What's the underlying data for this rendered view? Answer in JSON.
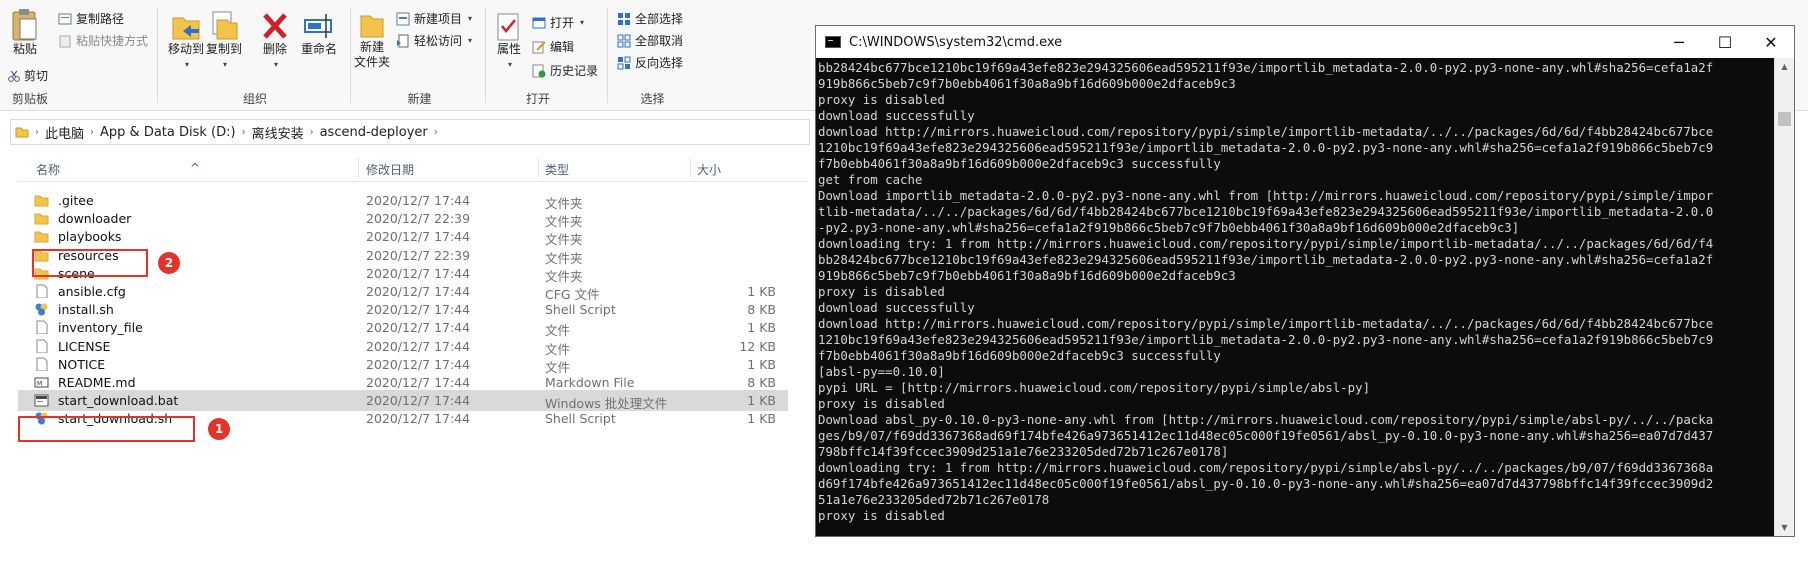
{
  "ribbon": {
    "clipboard": {
      "label": "剪贴板",
      "paste": "粘贴",
      "copy_path": "复制路径",
      "paste_shortcut": "粘贴快捷方式",
      "cut": "剪切"
    },
    "organize": {
      "label": "组织",
      "move_to": "移动到",
      "copy_to": "复制到",
      "delete": "删除",
      "rename": "重命名"
    },
    "new": {
      "label": "新建",
      "new_folder": "新建\n文件夹",
      "new_item": "新建项目",
      "easy_access": "轻松访问"
    },
    "open": {
      "label": "打开",
      "properties": "属性",
      "open": "打开",
      "edit": "编辑",
      "history": "历史记录"
    },
    "select": {
      "label": "选择",
      "select_all": "全部选择",
      "select_none": "全部取消",
      "invert": "反向选择"
    }
  },
  "address": {
    "crumbs": [
      "此电脑",
      "App & Data Disk (D:)",
      "离线安装",
      "ascend-deployer"
    ]
  },
  "columns": {
    "name": "名称",
    "date": "修改日期",
    "type": "类型",
    "size": "大小"
  },
  "files": [
    {
      "name": ".gitee",
      "date": "2020/12/7 17:44",
      "type": "文件夹",
      "size": "",
      "icon": "folder-icon"
    },
    {
      "name": "downloader",
      "date": "2020/12/7 22:39",
      "type": "文件夹",
      "size": "",
      "icon": "folder-icon"
    },
    {
      "name": "playbooks",
      "date": "2020/12/7 17:44",
      "type": "文件夹",
      "size": "",
      "icon": "folder-icon"
    },
    {
      "name": "resources",
      "date": "2020/12/7 22:39",
      "type": "文件夹",
      "size": "",
      "icon": "folder-icon"
    },
    {
      "name": "scene",
      "date": "2020/12/7 17:44",
      "type": "文件夹",
      "size": "",
      "icon": "folder-icon"
    },
    {
      "name": "ansible.cfg",
      "date": "2020/12/7 17:44",
      "type": "CFG 文件",
      "size": "1 KB",
      "icon": "file-icon"
    },
    {
      "name": "install.sh",
      "date": "2020/12/7 17:44",
      "type": "Shell Script",
      "size": "8 KB",
      "icon": "shell-script-icon"
    },
    {
      "name": "inventory_file",
      "date": "2020/12/7 17:44",
      "type": "文件",
      "size": "1 KB",
      "icon": "file-icon"
    },
    {
      "name": "LICENSE",
      "date": "2020/12/7 17:44",
      "type": "文件",
      "size": "12 KB",
      "icon": "file-icon"
    },
    {
      "name": "NOTICE",
      "date": "2020/12/7 17:44",
      "type": "文件",
      "size": "1 KB",
      "icon": "file-icon"
    },
    {
      "name": "README.md",
      "date": "2020/12/7 17:44",
      "type": "Markdown File",
      "size": "8 KB",
      "icon": "markdown-file-icon"
    },
    {
      "name": "start_download.bat",
      "date": "2020/12/7 17:44",
      "type": "Windows 批处理文件",
      "size": "1 KB",
      "icon": "batch-file-icon",
      "selected": true
    },
    {
      "name": "start_download.sh",
      "date": "2020/12/7 17:44",
      "type": "Shell Script",
      "size": "1 KB",
      "icon": "shell-script-icon"
    }
  ],
  "annotations": {
    "badge_1": "1",
    "badge_2": "2"
  },
  "cmd": {
    "title": "C:\\WINDOWS\\system32\\cmd.exe",
    "lines": [
      "bb28424bc677bce1210bc19f69a43efe823e294325606ead595211f93e/importlib_metadata-2.0.0-py2.py3-none-any.whl#sha256=cefa1a2f",
      "919b866c5beb7c9f7b0ebb4061f30a8a9bf16d609b000e2dfaceb9c3",
      "proxy is disabled",
      "download successfully",
      "download http://mirrors.huaweicloud.com/repository/pypi/simple/importlib-metadata/../../packages/6d/6d/f4bb28424bc677bce",
      "1210bc19f69a43efe823e294325606ead595211f93e/importlib_metadata-2.0.0-py2.py3-none-any.whl#sha256=cefa1a2f919b866c5beb7c9",
      "f7b0ebb4061f30a8a9bf16d609b000e2dfaceb9c3 successfully",
      "get from cache",
      "Download importlib_metadata-2.0.0-py2.py3-none-any.whl from [http://mirrors.huaweicloud.com/repository/pypi/simple/impor",
      "tlib-metadata/../../packages/6d/6d/f4bb28424bc677bce1210bc19f69a43efe823e294325606ead595211f93e/importlib_metadata-2.0.0",
      "-py2.py3-none-any.whl#sha256=cefa1a2f919b866c5beb7c9f7b0ebb4061f30a8a9bf16d609b000e2dfaceb9c3]",
      "downloading try: 1 from http://mirrors.huaweicloud.com/repository/pypi/simple/importlib-metadata/../../packages/6d/6d/f4",
      "bb28424bc677bce1210bc19f69a43efe823e294325606ead595211f93e/importlib_metadata-2.0.0-py2.py3-none-any.whl#sha256=cefa1a2f",
      "919b866c5beb7c9f7b0ebb4061f30a8a9bf16d609b000e2dfaceb9c3",
      "proxy is disabled",
      "download successfully",
      "download http://mirrors.huaweicloud.com/repository/pypi/simple/importlib-metadata/../../packages/6d/6d/f4bb28424bc677bce",
      "1210bc19f69a43efe823e294325606ead595211f93e/importlib_metadata-2.0.0-py2.py3-none-any.whl#sha256=cefa1a2f919b866c5beb7c9",
      "f7b0ebb4061f30a8a9bf16d609b000e2dfaceb9c3 successfully",
      "[absl-py==0.10.0]",
      "pypi URL = [http://mirrors.huaweicloud.com/repository/pypi/simple/absl-py]",
      "proxy is disabled",
      "Download absl_py-0.10.0-py3-none-any.whl from [http://mirrors.huaweicloud.com/repository/pypi/simple/absl-py/../../packa",
      "ges/b9/07/f69dd3367368ad69f174bfe426a973651412ec11d48ec05c000f19fe0561/absl_py-0.10.0-py3-none-any.whl#sha256=ea07d7d437",
      "798bffc14f39fccec3909d251a1e76e233205ded72b71c267e0178]",
      "downloading try: 1 from http://mirrors.huaweicloud.com/repository/pypi/simple/absl-py/../../packages/b9/07/f69dd3367368a",
      "d69f174bfe426a973651412ec11d48ec05c000f19fe0561/absl_py-0.10.0-py3-none-any.whl#sha256=ea07d7d437798bffc14f39fccec3909d2",
      "51a1e76e233205ded72b71c267e0178",
      "proxy is disabled"
    ]
  }
}
